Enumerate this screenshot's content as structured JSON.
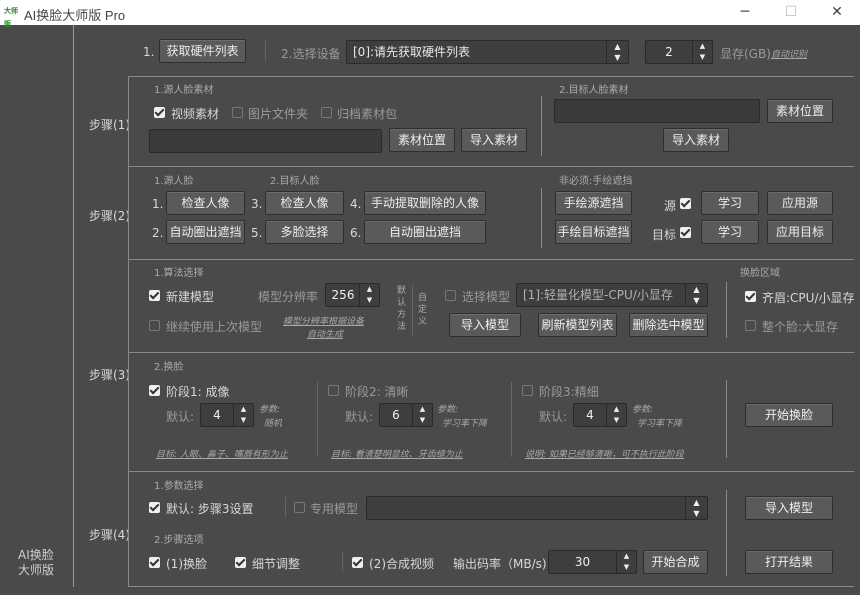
{
  "window": {
    "logo_text": "大师版",
    "title": "AI换脸大师版 Pro",
    "minimize": "─",
    "maximize": "☐",
    "close": "✕"
  },
  "sidebar": {
    "brand_line1": "AI换脸",
    "brand_line2": "大师版"
  },
  "hardware": {
    "step1_num": "1.",
    "get_hardware_button": "获取硬件列表",
    "step2_label": "2.选择设备",
    "device_value": "[0]:请先获取硬件列表",
    "vram_value": "2",
    "vram_label": "显存(GB)",
    "auto_detect_link": "自动识别"
  },
  "step1": {
    "label": "步骤(1)",
    "source_title": "1.源人脸素材",
    "video_material": "视频素材",
    "image_folder": "图片文件夹",
    "archive_pack": "归档素材包",
    "source_location_button": "素材位置",
    "source_import_button": "导入素材",
    "target_title": "2.目标人脸素材",
    "target_location_button": "素材位置",
    "target_import_button": "导入素材"
  },
  "step2": {
    "label": "步骤(2)",
    "source_face_title": "1.源人脸",
    "target_face_title": "2.目标人脸",
    "optional_title": "非必须:手绘遮挡",
    "n1": "1.",
    "check_face_1": "检查人像",
    "n3": "3.",
    "check_face_2": "检查人像",
    "n4": "4.",
    "manual_extract": "手动提取删除的人像",
    "n2": "2.",
    "auto_mask_1": "自动圈出遮挡",
    "n5": "5.",
    "multi_face": "多脸选择",
    "n6": "6.",
    "auto_mask_2": "自动圈出遮挡",
    "draw_source_mask": "手绘源遮挡",
    "source_label": "源",
    "learn_1": "学习",
    "apply_source": "应用源",
    "draw_target_mask": "手绘目标遮挡",
    "target_label": "目标",
    "learn_2": "学习",
    "apply_target": "应用目标"
  },
  "algo": {
    "title": "1.算法选择",
    "new_model": "新建模型",
    "resolution_label": "模型分辨率",
    "resolution_value": "256",
    "continue_last": "继续使用上次模型",
    "note_line1": "模型分辨率根据设备",
    "note_line2": "自动生成",
    "default_method": "默认方法",
    "custom_method": "自定义",
    "select_model": "选择模型",
    "model_value": "[1]:轻量化模型-CPU/小显存",
    "import_model": "导入模型",
    "refresh_models": "刷新模型列表",
    "delete_model": "删除选中模型",
    "swap_region_title": "换脸区域",
    "eyebrow_cpu": "齐眉:CPU/小显存",
    "full_face": "整个脸:大显存"
  },
  "step3": {
    "label": "步骤(3)",
    "title": "2.换脸",
    "stage1": "阶段1: 成像",
    "stage2": "阶段2: 清晰",
    "stage3": "阶段3:精细",
    "default_label": "默认:",
    "stage1_value": "4",
    "stage2_value": "6",
    "stage3_value": "4",
    "param_label": "参数:",
    "stage1_param": "随机",
    "stage2_param": "学习率下降",
    "stage3_param": "学习率下降",
    "stage1_goal": "目标: 人眼、鼻子、嘴唇有形为止",
    "stage2_goal": "目标: 看清楚明显纹、牙齿缝为止",
    "stage3_goal": "说明: 如果已经够清晰，可不执行此阶段",
    "start_swap": "开始换脸"
  },
  "step4": {
    "label": "步骤(4)",
    "params_title": "1.参数选择",
    "default_setting": "默认: 步骤3设置",
    "dedicated_model": "专用模型",
    "import_model": "导入模型",
    "options_title": "2.步骤选项",
    "opt_swap": "(1)换脸",
    "opt_detail": "细节调整",
    "opt_video": "(2)合成视频",
    "bitrate_label": "输出码率（MB/s)",
    "bitrate_value": "30",
    "start_compose": "开始合成",
    "open_result": "打开结果"
  }
}
